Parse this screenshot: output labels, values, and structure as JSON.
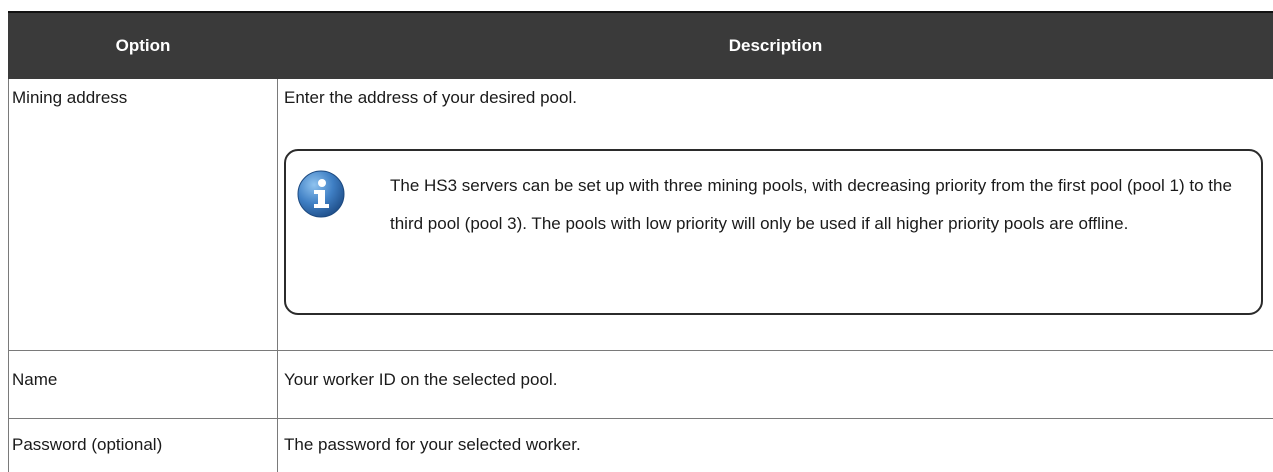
{
  "table": {
    "headers": {
      "option": "Option",
      "description": "Description"
    },
    "rows": [
      {
        "option": "Mining address",
        "description": "Enter the address of your desired pool.",
        "note": {
          "icon": "info-icon",
          "text": "The HS3 servers can be set up with three mining pools, with decreasing priority from the first pool (pool 1) to the third pool (pool 3). The pools with low priority will only be used if all higher priority pools are offline."
        }
      },
      {
        "option": "Name",
        "description": "Your worker ID on the selected pool."
      },
      {
        "option": "Password (optional)",
        "description": "The password for your selected worker."
      }
    ]
  },
  "colors": {
    "header_background": "#3a3a3a",
    "header_text": "#ffffff",
    "info_icon_blue": "#2f6db3"
  }
}
